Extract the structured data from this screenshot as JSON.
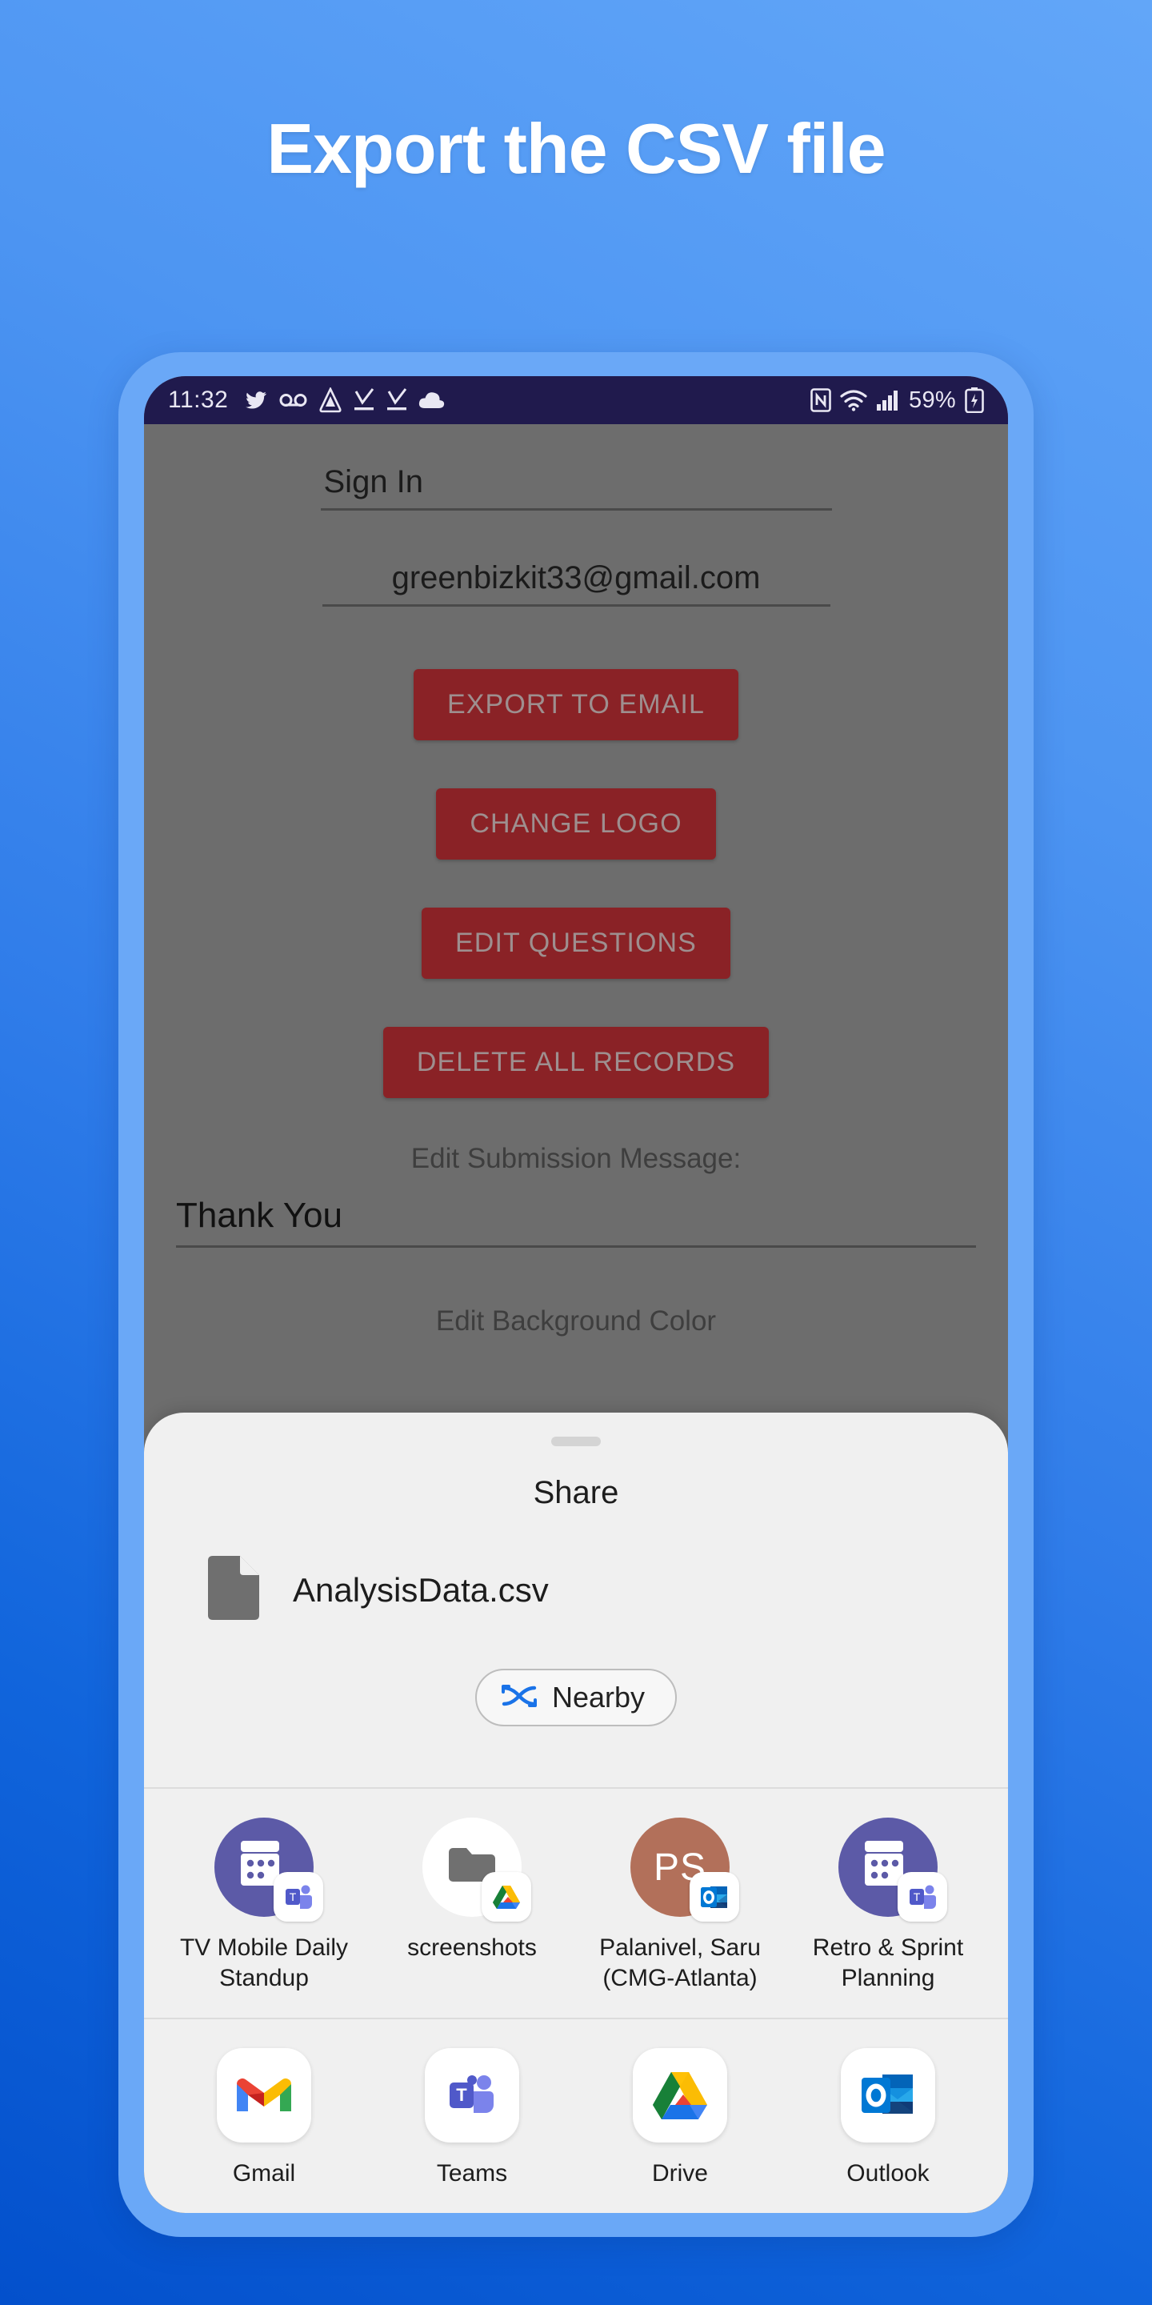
{
  "headline": "Export the CSV file",
  "statusbar": {
    "time": "11:32",
    "left_icons": [
      "twitter-icon",
      "voicemail-icon",
      "drive-icon",
      "download-complete-icon",
      "download-complete-icon-2",
      "cloud-icon"
    ],
    "right_icons": [
      "nfc-icon",
      "wifi-icon",
      "cellular-signal-icon"
    ],
    "battery_percent": "59%",
    "battery_icon": "battery-charging-icon"
  },
  "app": {
    "signin_label": "Sign In",
    "email_value": "greenbizkit33@gmail.com",
    "buttons": [
      {
        "label": "EXPORT TO EMAIL",
        "name": "export-to-email-button"
      },
      {
        "label": "CHANGE LOGO",
        "name": "change-logo-button"
      },
      {
        "label": "EDIT QUESTIONS",
        "name": "edit-questions-button"
      },
      {
        "label": "DELETE ALL RECORDS",
        "name": "delete-all-records-button"
      }
    ],
    "submission_label": "Edit Submission Message:",
    "submission_value": "Thank You",
    "background_color_label": "Edit Background Color",
    "button_color": "#8a2226",
    "scrim_color": "#6d6d6d"
  },
  "share_sheet": {
    "title": "Share",
    "file_name": "AnalysisData.csv",
    "nearby_label": "Nearby",
    "contacts": [
      {
        "label": "TV Mobile Daily Standup",
        "avatar": "calendar-avatar",
        "avatar_color": "#5c5aa7",
        "badge": "teams-badge-icon"
      },
      {
        "label": "screenshots",
        "avatar": "folder-avatar",
        "avatar_color": "#ffffff",
        "badge": "drive-badge-icon"
      },
      {
        "label": "Palanivel, Saru (CMG-Atlanta)",
        "avatar": "initials-avatar",
        "avatar_color": "#b2705a",
        "initials": "PS",
        "badge": "outlook-badge-icon"
      },
      {
        "label": "Retro & Sprint Planning",
        "avatar": "calendar-avatar",
        "avatar_color": "#5c5aa7",
        "badge": "teams-badge-icon"
      }
    ],
    "apps": [
      {
        "label": "Gmail",
        "icon": "gmail-icon"
      },
      {
        "label": "Teams",
        "icon": "teams-icon"
      },
      {
        "label": "Drive",
        "icon": "drive-icon"
      },
      {
        "label": "Outlook",
        "icon": "outlook-icon"
      }
    ]
  },
  "theme": {
    "bg_top": "#62a6f8",
    "bg_bottom": "#0350cc",
    "phone_frame": "#6aa8f7",
    "statusbar_bg": "#201a4d",
    "sheet_bg": "#f0f0f0",
    "nearby_accent": "#1a73e8"
  }
}
